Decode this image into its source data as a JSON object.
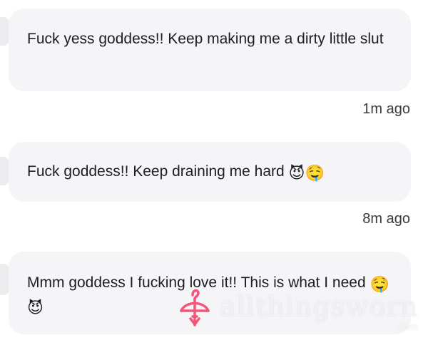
{
  "messages": [
    {
      "text": "Fuck yess goddess!! Keep making me a dirty little slut",
      "emojis": [],
      "timestamp": "1m ago"
    },
    {
      "text": "Fuck goddess!! Keep draining me hard ",
      "emojis": [
        "😈",
        "🤤"
      ],
      "timestamp": "8m ago"
    },
    {
      "text": "Mmm goddess I fucking love it!! This is what I need ",
      "emojis": [
        "🤤",
        "😈"
      ],
      "timestamp": ""
    }
  ],
  "watermark": {
    "text": "allthingsworn",
    "subtext": "com",
    "logo_icon": "hanger-bow-icon",
    "logo_color": "#f2557a"
  },
  "colors": {
    "bubble_bg": "#f5f5f7",
    "text": "#1e1e22",
    "timestamp": "#3a3a40"
  }
}
